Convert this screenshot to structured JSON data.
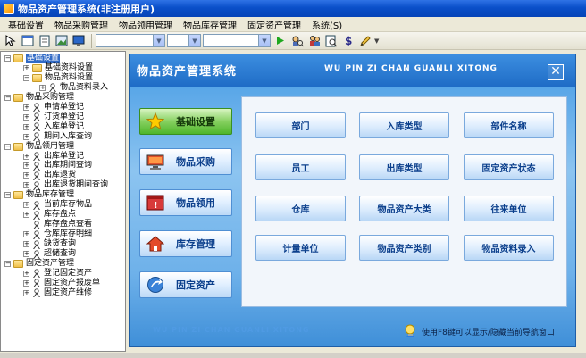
{
  "window": {
    "title": "物品资产管理系统(非注册用户)"
  },
  "menubar": {
    "items": [
      "基础设置",
      "物品采购管理",
      "物品领用管理",
      "物品库存管理",
      "固定资产管理",
      "系统(S)"
    ]
  },
  "tree": {
    "items": [
      {
        "label": "基础设置",
        "level": 0,
        "type": "folder",
        "expander": "-",
        "selected": true
      },
      {
        "label": "基础资料设置",
        "level": 1,
        "type": "folder",
        "expander": "+"
      },
      {
        "label": "物品资料设置",
        "level": 1,
        "type": "folder",
        "expander": "-"
      },
      {
        "label": "物品资料录入",
        "level": 2,
        "type": "leaf",
        "expander": "+"
      },
      {
        "label": "物品采购管理",
        "level": 0,
        "type": "folder",
        "expander": "-"
      },
      {
        "label": "申请单登记",
        "level": 1,
        "type": "leaf",
        "expander": "+"
      },
      {
        "label": "订货单登记",
        "level": 1,
        "type": "leaf",
        "expander": "+"
      },
      {
        "label": "入库单登记",
        "level": 1,
        "type": "leaf",
        "expander": "+"
      },
      {
        "label": "期间入库查询",
        "level": 1,
        "type": "leaf",
        "expander": "+"
      },
      {
        "label": "物品领用管理",
        "level": 0,
        "type": "folder",
        "expander": "-"
      },
      {
        "label": "出库单登记",
        "level": 1,
        "type": "leaf",
        "expander": "+"
      },
      {
        "label": "出库期间查询",
        "level": 1,
        "type": "leaf",
        "expander": "+"
      },
      {
        "label": "出库退货",
        "level": 1,
        "type": "leaf",
        "expander": "+"
      },
      {
        "label": "出库退货期间查询",
        "level": 1,
        "type": "leaf",
        "expander": "+"
      },
      {
        "label": "物品库存管理",
        "level": 0,
        "type": "folder",
        "expander": "-"
      },
      {
        "label": "当前库存物品",
        "level": 1,
        "type": "leaf",
        "expander": "+"
      },
      {
        "label": "库存盘点",
        "level": 1,
        "type": "leaf",
        "expander": "+"
      },
      {
        "label": "库存盘点查看",
        "level": 1,
        "type": "leaf",
        "expander": ""
      },
      {
        "label": "仓库库存明细",
        "level": 1,
        "type": "leaf",
        "expander": "+"
      },
      {
        "label": "缺货查询",
        "level": 1,
        "type": "leaf",
        "expander": "+"
      },
      {
        "label": "超储查询",
        "level": 1,
        "type": "leaf",
        "expander": "+"
      },
      {
        "label": "固定资产管理",
        "level": 0,
        "type": "folder",
        "expander": "-"
      },
      {
        "label": "登记固定资产",
        "level": 1,
        "type": "leaf",
        "expander": "+"
      },
      {
        "label": "固定资产报废单",
        "level": 1,
        "type": "leaf",
        "expander": "+"
      },
      {
        "label": "固定资产维修",
        "level": 1,
        "type": "leaf",
        "expander": "+"
      }
    ]
  },
  "panel": {
    "title": "物品资产管理系统",
    "subtitle": "WU PIN ZI CHAN GUANLI XITONG",
    "footer_text": "WU PIN ZI CHAN GUANLI XITONG",
    "close_label": "✕",
    "hint": "使用F8键可以显示/隐藏当前导航窗口",
    "side_buttons": [
      {
        "label": "基础设置",
        "icon": "star-icon",
        "active": true
      },
      {
        "label": "物品采购",
        "icon": "monitor-icon",
        "active": false
      },
      {
        "label": "物品领用",
        "icon": "alert-window-icon",
        "active": false
      },
      {
        "label": "库存管理",
        "icon": "house-icon",
        "active": false
      },
      {
        "label": "固定资产",
        "icon": "arrow-icon",
        "active": false
      }
    ],
    "grid_buttons": [
      "部门",
      "入库类型",
      "部件名称",
      "员工",
      "出库类型",
      "固定资产状态",
      "仓库",
      "物品资产大类",
      "往来单位",
      "计量单位",
      "物品资产类别",
      "物品资料录入"
    ]
  },
  "colors": {
    "title_bar": "#0a4fc9",
    "panel_blue": "#5aa7e8",
    "active_green": "#86d060",
    "button_text": "#0b3f8c"
  }
}
